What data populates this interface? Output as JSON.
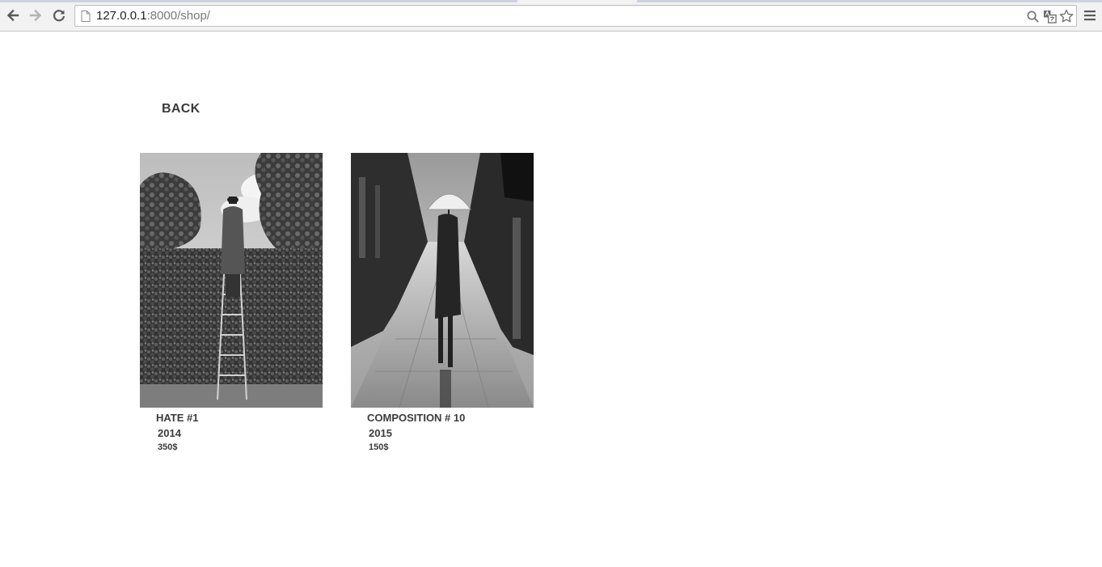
{
  "browser": {
    "url_host": "127.0.0.1",
    "url_path": ":8000/shop/",
    "icons": {
      "back": "back-arrow-icon",
      "forward": "forward-arrow-icon",
      "reload": "reload-icon",
      "page": "page-icon",
      "search": "magnifier-icon",
      "translate": "translate-icon",
      "bookmark": "star-icon",
      "menu": "hamburger-menu-icon"
    }
  },
  "page": {
    "back_label": "BACK",
    "products": [
      {
        "title": "HATE #1",
        "year": "2014",
        "price": "350$"
      },
      {
        "title": "COMPOSITION # 10",
        "year": "2015",
        "price": "150$"
      }
    ]
  }
}
